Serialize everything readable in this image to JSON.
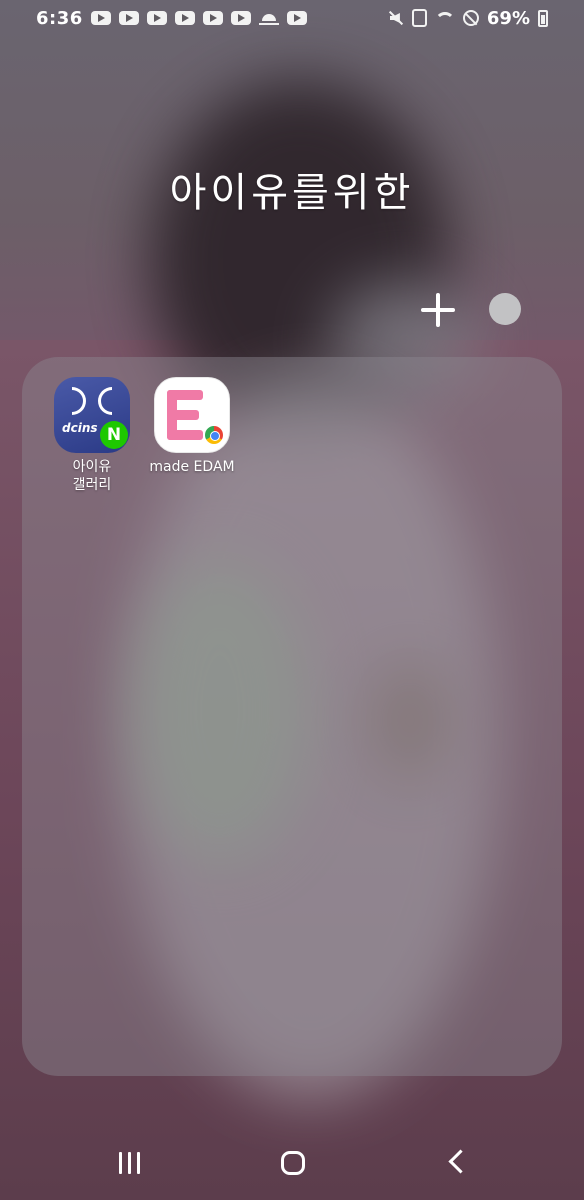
{
  "status_bar": {
    "time": "6:36",
    "battery_percent": "69%",
    "notification_icons": [
      "youtube-icon",
      "youtube-icon",
      "youtube-icon",
      "youtube-icon",
      "youtube-icon",
      "youtube-icon",
      "weather-icon",
      "youtube-icon"
    ]
  },
  "folder": {
    "title": "아이유를위한",
    "apps": [
      {
        "label": "아이유\n갤러리",
        "icon": "dcinside-icon",
        "badge": "N"
      },
      {
        "label": "made EDAM",
        "icon": "edam-icon",
        "badge": "chrome"
      }
    ]
  },
  "navbar": {
    "items": [
      "recents-button",
      "home-button",
      "back-button"
    ]
  }
}
